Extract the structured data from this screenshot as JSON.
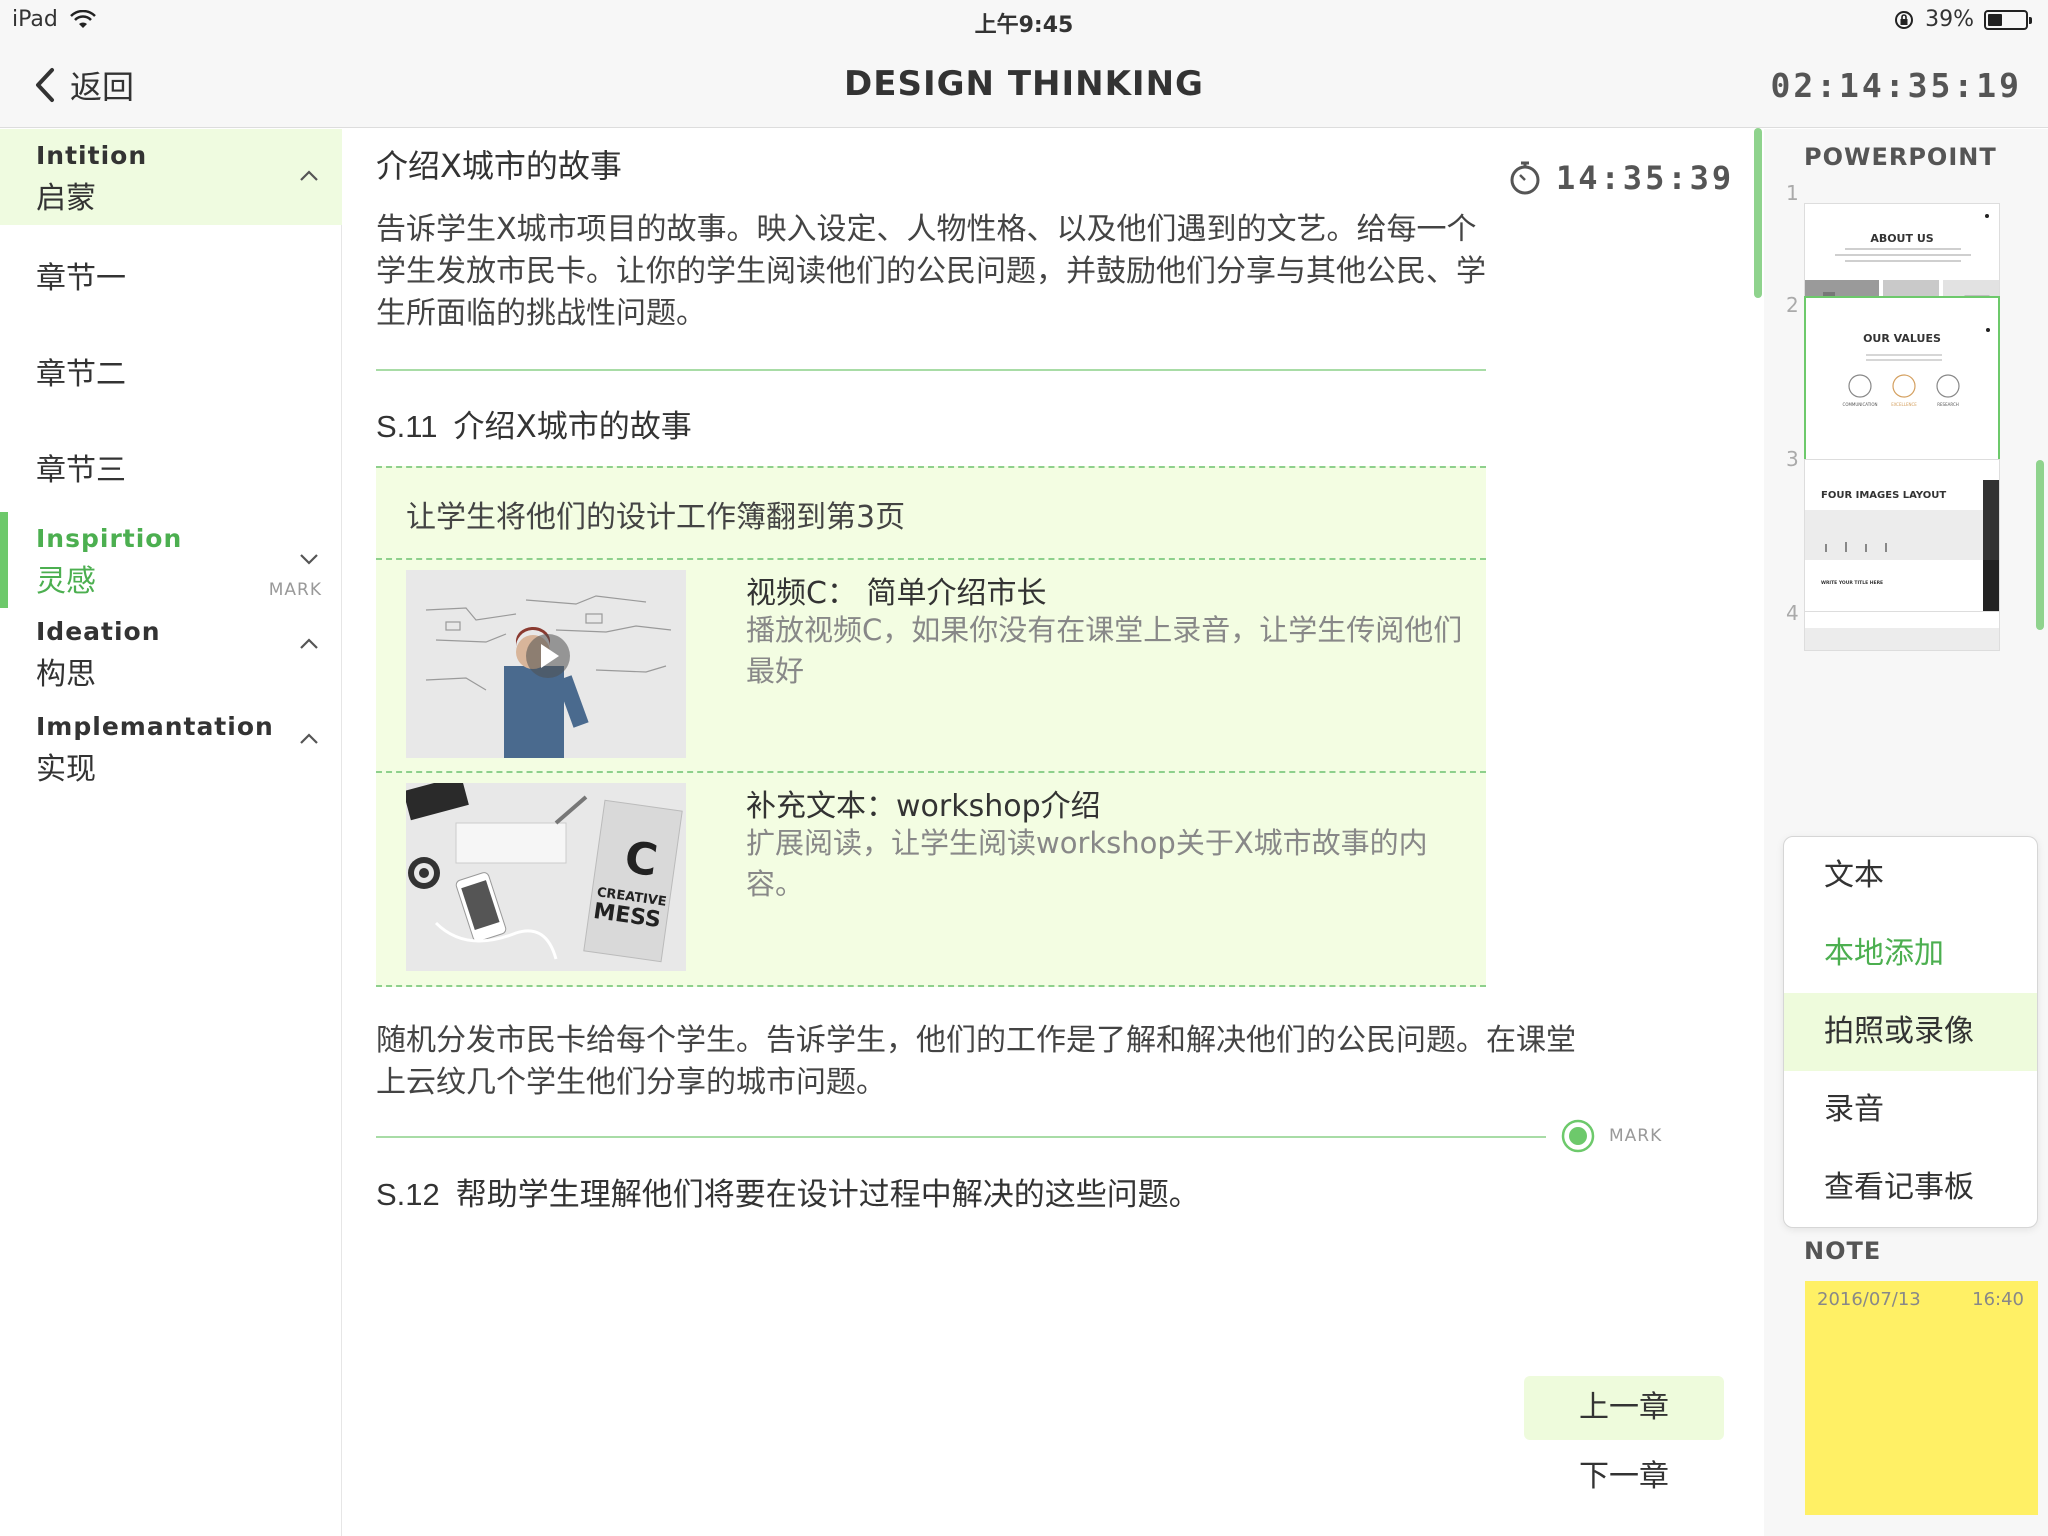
{
  "status_bar": {
    "device": "iPad",
    "time": "上午9:45",
    "battery": "39%",
    "battery_level": 0.39
  },
  "nav": {
    "back_label": "返回",
    "title": "DESIGN THINKING",
    "timer": "02:14:35:19"
  },
  "sidebar": {
    "sections": [
      {
        "en": "Intition",
        "cn": "启蒙",
        "expanded": true
      },
      {
        "en": "Inspirtion",
        "cn": "灵感",
        "expanded": false,
        "active": true
      },
      {
        "en": "Ideation",
        "cn": "构思",
        "expanded": true
      },
      {
        "en": "Implemantation",
        "cn": "实现",
        "expanded": true
      }
    ],
    "chapters": [
      "章节一",
      "章节二",
      "章节三"
    ],
    "mark_label": "MARK"
  },
  "main": {
    "title": "介绍X城市的故事",
    "clock": "14:35:39",
    "intro": "告诉学生X城市项目的故事。映入设定、人物性格、以及他们遇到的文艺。给每一个学生发放市民卡。让你的学生阅读他们的公民问题，并鼓励他们分享与其他公民、学生所面临的挑战性问题。",
    "s11": {
      "num": "S.11",
      "title": "介绍X城市的故事",
      "box_head": "让学生将他们的设计工作簿翻到第3页",
      "media": [
        {
          "title": "视频C：  简单介绍市长",
          "desc": "播放视频C，如果你没有在课堂上录音，让学生传阅他们最好"
        },
        {
          "title": "补充文本：workshop介绍",
          "desc": "扩展阅读，让学生阅读workshop关于X城市故事的内容。",
          "book_letter": "C",
          "book_text_1": "CREATIVE",
          "book_text_2": "MESS"
        }
      ]
    },
    "paragraph": "随机分发市民卡给每个学生。告诉学生，他们的工作是了解和解决他们的公民问题。在课堂上云纹几个学生他们分享的城市问题。",
    "mark_label": "MARK",
    "s12": {
      "num": "S.12",
      "title": "帮助学生理解他们将要在设计过程中解决的这些问题。"
    },
    "prev_label": "上一章",
    "next_label": "下一章"
  },
  "right_panel": {
    "powerpoint_label": "POWERPOINT",
    "slides": [
      {
        "num": "1",
        "title": "ABOUT US"
      },
      {
        "num": "2",
        "title": "OUR VALUES",
        "labels": [
          "COMMUNICATION",
          "EXCELLENCE",
          "RESEARCH"
        ],
        "selected": true
      },
      {
        "num": "3",
        "title": "FOUR IMAGES LAYOUT",
        "sub": "WRITE YOUR TITLE HERE"
      },
      {
        "num": "4"
      }
    ],
    "popup_items": [
      {
        "label": "文本",
        "style": "normal"
      },
      {
        "label": "本地添加",
        "style": "green"
      },
      {
        "label": "拍照或录像",
        "style": "highlight"
      },
      {
        "label": "录音",
        "style": "normal"
      },
      {
        "label": "查看记事板",
        "style": "normal"
      }
    ],
    "note_label": "NOTE",
    "note": {
      "date": "2016/07/13",
      "time": "16:40"
    }
  },
  "colors": {
    "accent_green": "#6dc96b",
    "light_green_bg": "#f3fde2",
    "note_yellow": "#fff065"
  }
}
